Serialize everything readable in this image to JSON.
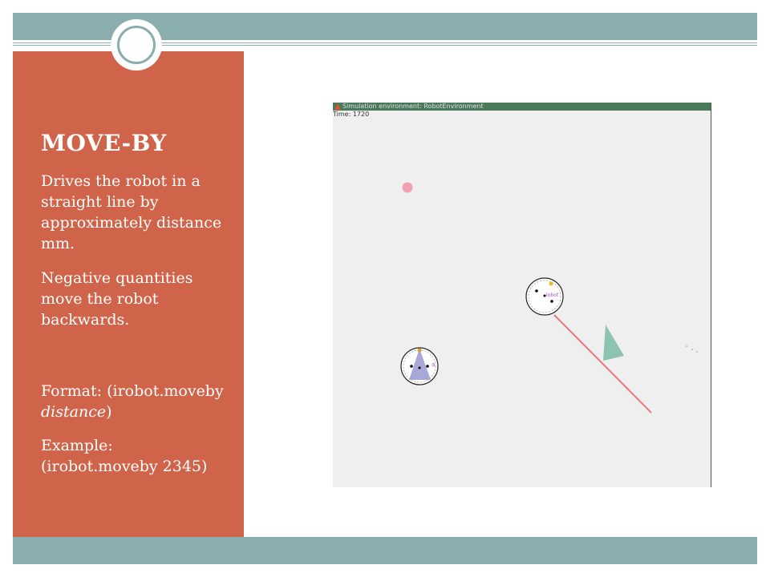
{
  "slide": {
    "title": "MOVE-BY",
    "paragraph1": "Drives the robot in a straight line by approximately distance mm.",
    "paragraph2": "Negative quantities move the robot backwards.",
    "format_prefix": "Format: (irobot.moveby ",
    "format_arg": "distance",
    "format_suffix": ")",
    "example_label": "Example:",
    "example_code": "(irobot.moveby 2345)"
  },
  "simulator": {
    "window_title": "Simulation environment: RobotEnvironment",
    "status_text": "Time: 1720",
    "robot1_label": "a",
    "robot2_label": "lobot"
  },
  "colors": {
    "accent_teal": "#8aadad",
    "panel_orange": "#d0644a",
    "beam_pink": "#e87880",
    "cone_blue": "#a8a8d8",
    "triangle_green": "#8cc4b0"
  }
}
